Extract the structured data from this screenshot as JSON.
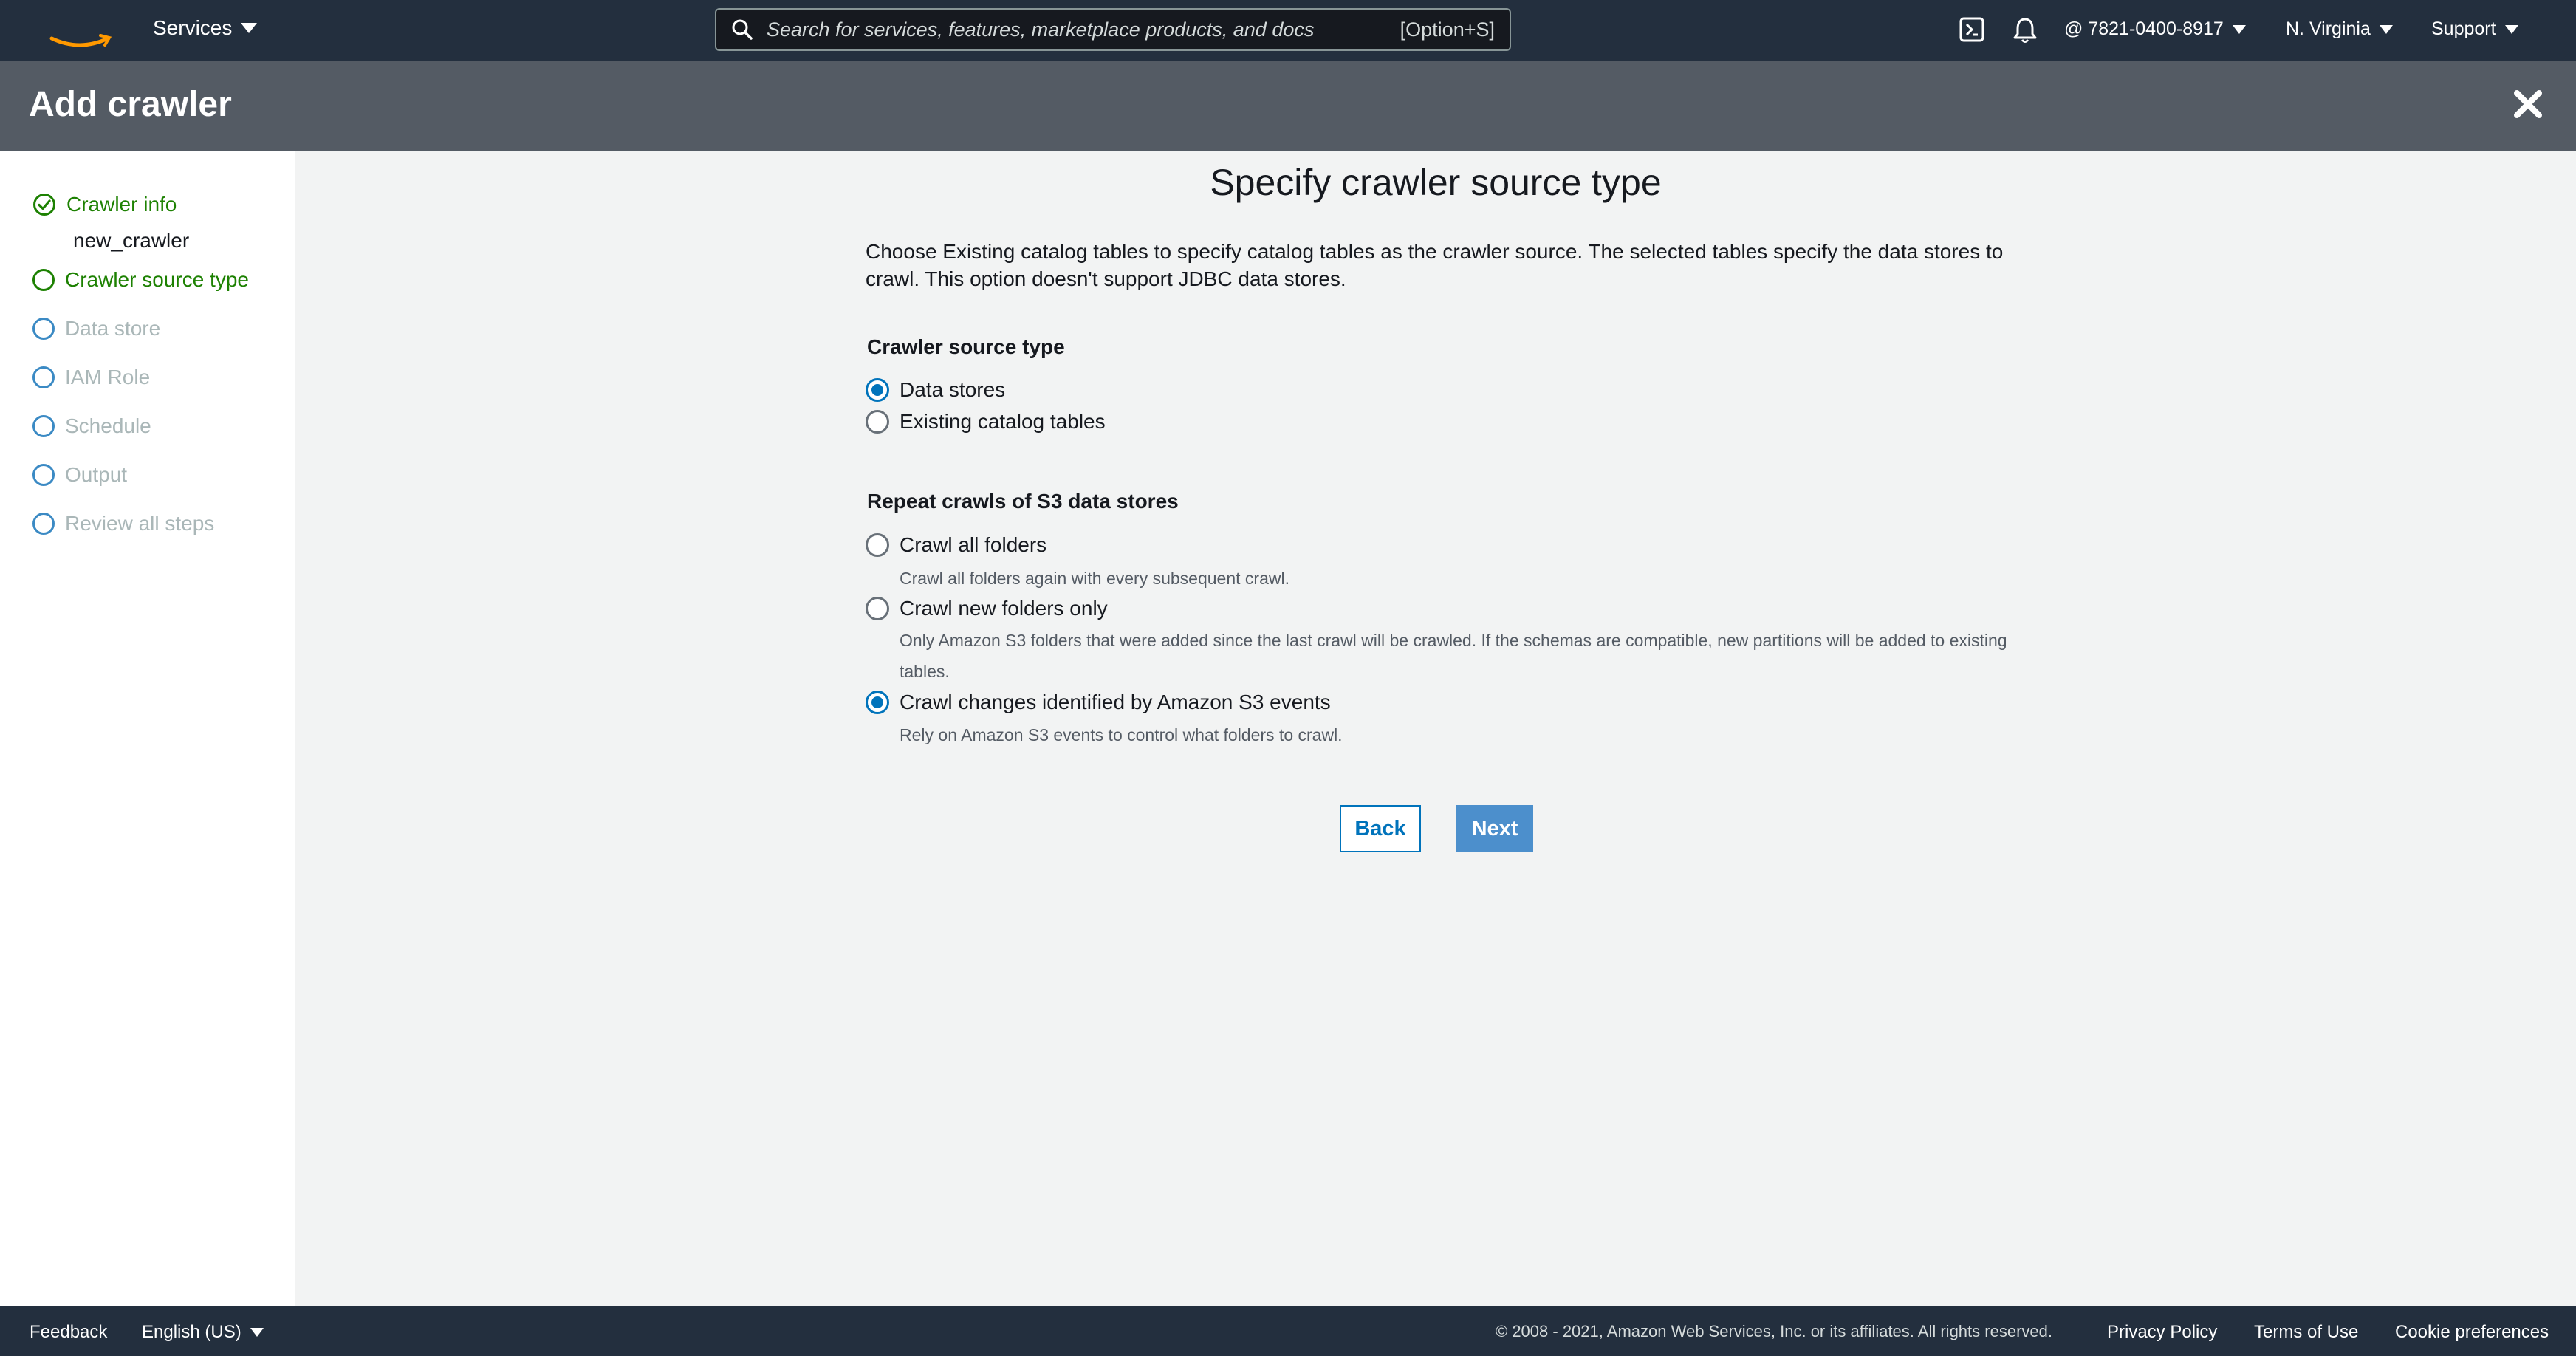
{
  "topnav": {
    "services_label": "Services",
    "search": {
      "placeholder": "Search for services, features, marketplace products, and docs",
      "shortcut": "[Option+S]"
    },
    "account": "@ 7821-0400-8917",
    "region": "N. Virginia",
    "support": "Support"
  },
  "header": {
    "title": "Add crawler"
  },
  "steps": [
    {
      "label": "Crawler info",
      "state": "done",
      "value": "new_crawler"
    },
    {
      "label": "Crawler source type",
      "state": "active"
    },
    {
      "label": "Data store",
      "state": "pending"
    },
    {
      "label": "IAM Role",
      "state": "pending"
    },
    {
      "label": "Schedule",
      "state": "pending"
    },
    {
      "label": "Output",
      "state": "pending"
    },
    {
      "label": "Review all steps",
      "state": "pending"
    }
  ],
  "main": {
    "title": "Specify crawler source type",
    "description": "Choose Existing catalog tables to specify catalog tables as the crawler source. The selected tables specify the data stores to crawl. This option doesn't support JDBC data stores.",
    "source_type": {
      "label": "Crawler source type",
      "options": [
        {
          "label": "Data stores",
          "checked": true
        },
        {
          "label": "Existing catalog tables",
          "checked": false
        }
      ]
    },
    "repeat_crawls": {
      "label": "Repeat crawls of S3 data stores",
      "options": [
        {
          "label": "Crawl all folders",
          "help": "Crawl all folders again with every subsequent crawl.",
          "checked": false
        },
        {
          "label": "Crawl new folders only",
          "help": "Only Amazon S3 folders that were added since the last crawl will be crawled. If the schemas are compatible, new partitions will be added to existing tables.",
          "checked": false
        },
        {
          "label": "Crawl changes identified by Amazon S3 events",
          "help": "Rely on Amazon S3 events to control what folders to crawl.",
          "checked": true
        }
      ]
    },
    "back_label": "Back",
    "next_label": "Next"
  },
  "footer": {
    "feedback": "Feedback",
    "language": "English (US)",
    "copyright": "© 2008 - 2021, Amazon Web Services, Inc. or its affiliates. All rights reserved.",
    "privacy": "Privacy Policy",
    "terms": "Terms of Use",
    "cookies": "Cookie preferences"
  },
  "colors": {
    "nav_bg": "#232f3e",
    "header_bg": "#545b64",
    "success": "#1d8102",
    "primary": "#0073bb"
  }
}
